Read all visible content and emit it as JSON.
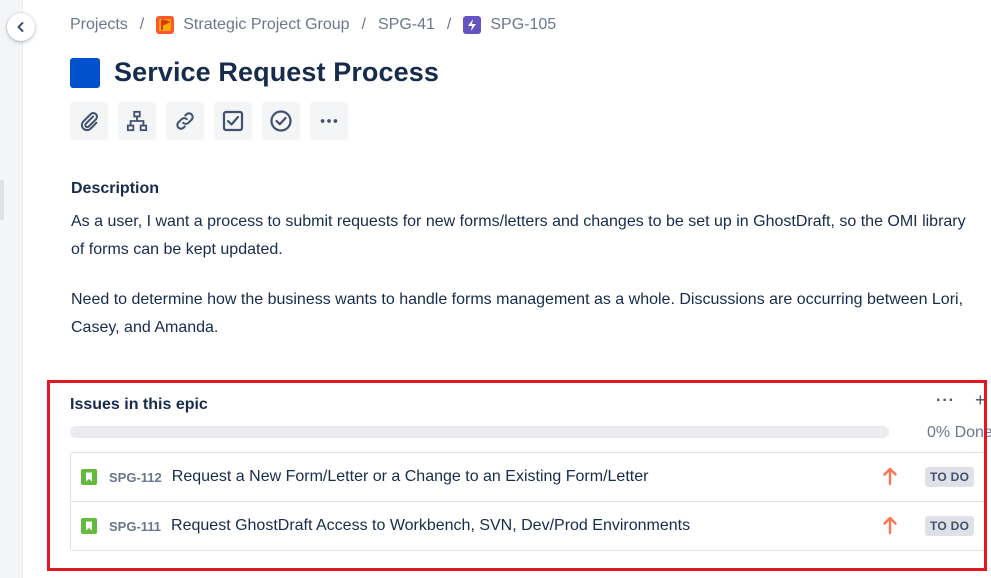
{
  "breadcrumb": {
    "items": [
      {
        "label": "Projects"
      },
      {
        "label": "Strategic Project Group"
      },
      {
        "label": "SPG-41"
      },
      {
        "label": "SPG-105"
      }
    ],
    "separator": "/"
  },
  "issue": {
    "title": "Service Request Process",
    "epic_color": "#0052cc"
  },
  "toolbar": {
    "icons": [
      "paperclip-icon",
      "child-issues-icon",
      "link-icon",
      "checkbox-icon",
      "check-circle-icon",
      "more-icon"
    ]
  },
  "description": {
    "label": "Description",
    "paragraphs": [
      "As a user, I want a process to submit requests for new forms/letters and changes to be set up in GhostDraft, so the OMI library of forms can be kept updated.",
      "Need to determine how the business wants to handle forms management as a whole.  Discussions are occurring between Lori, Casey, and Amanda."
    ]
  },
  "epic_issues": {
    "heading": "Issues in this epic",
    "more_label": "···",
    "add_label": "+",
    "progress_label": "0% Done",
    "progress_fraction": 0,
    "items": [
      {
        "key": "SPG-112",
        "summary": "Request a New Form/Letter or a Change to an Existing Form/Letter",
        "priority": "high",
        "status": "TO DO"
      },
      {
        "key": "SPG-111",
        "summary": "Request GhostDraft Access to Workbench, SVN, Dev/Prod Environments",
        "priority": "high",
        "status": "TO DO"
      }
    ]
  },
  "colors": {
    "highlight_border": "#e3171f",
    "story_icon": "#63ba3c",
    "priority_high": "#ff7452",
    "project_icon": "#ff5630",
    "epic_crumb_icon": "#6554c0"
  }
}
